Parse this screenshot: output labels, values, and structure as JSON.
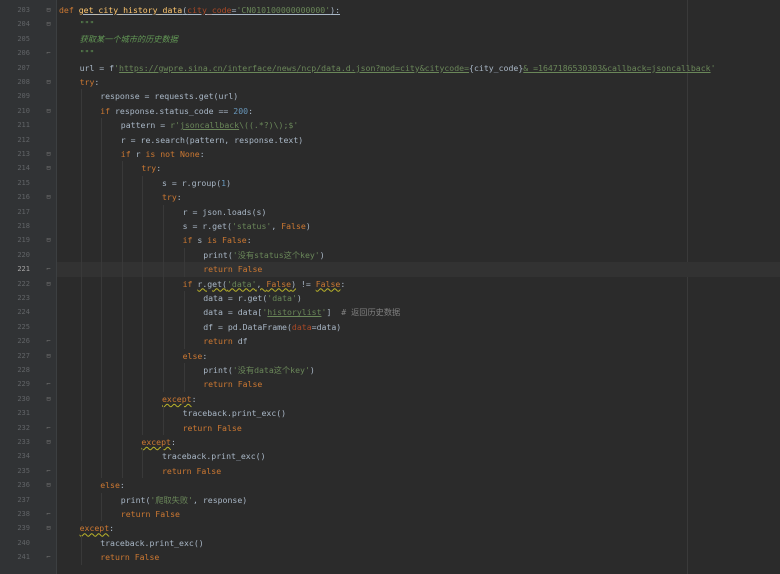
{
  "editor": {
    "current_line": 221,
    "lines": [
      {
        "n": "203",
        "indent": 0,
        "fold": "top",
        "tokens": [
          [
            "kw",
            "def "
          ],
          [
            "fn u2",
            "get_city_history_data"
          ],
          [
            "plain u2",
            "("
          ],
          [
            "param u2",
            "city_code"
          ],
          [
            "plain u2",
            "="
          ],
          [
            "str u2",
            "'CN010100000000000'"
          ],
          [
            "plain u2",
            "):"
          ]
        ]
      },
      {
        "n": "204",
        "indent": 1,
        "fold": "top",
        "tokens": [
          [
            "doc",
            "\"\"\""
          ]
        ]
      },
      {
        "n": "205",
        "indent": 1,
        "fold": "",
        "tokens": [
          [
            "doc",
            "获取某一个城市的历史数据"
          ]
        ]
      },
      {
        "n": "206",
        "indent": 1,
        "fold": "bot",
        "tokens": [
          [
            "doc",
            "\"\"\""
          ]
        ]
      },
      {
        "n": "207",
        "indent": 1,
        "fold": "",
        "tokens": [
          [
            "plain",
            "url = f"
          ],
          [
            "str",
            "'"
          ],
          [
            "str u",
            "https://gwpre.sina.cn/interface/news/ncp/data.d.json?mod=city&citycode="
          ],
          [
            "plain",
            "{city_code}"
          ],
          [
            "str u",
            "&_=1647186530303&callback=jsoncallback"
          ],
          [
            "str",
            "'"
          ]
        ]
      },
      {
        "n": "208",
        "indent": 1,
        "fold": "top",
        "tokens": [
          [
            "kw",
            "try"
          ],
          [
            "plain",
            ":"
          ]
        ]
      },
      {
        "n": "209",
        "indent": 2,
        "fold": "",
        "tokens": [
          [
            "plain",
            "response = requests.get(url)"
          ]
        ]
      },
      {
        "n": "210",
        "indent": 2,
        "fold": "top",
        "tokens": [
          [
            "kw",
            "if "
          ],
          [
            "plain",
            "response.status_code == "
          ],
          [
            "num",
            "200"
          ],
          [
            "plain",
            ":"
          ]
        ]
      },
      {
        "n": "211",
        "indent": 3,
        "fold": "",
        "tokens": [
          [
            "plain",
            "pattern = "
          ],
          [
            "str",
            "r'"
          ],
          [
            "str u",
            "jsoncallback"
          ],
          [
            "str",
            "\\((.*?)\\);$'"
          ]
        ]
      },
      {
        "n": "212",
        "indent": 3,
        "fold": "",
        "tokens": [
          [
            "plain",
            "r = re.search(pattern, response.text)"
          ]
        ]
      },
      {
        "n": "213",
        "indent": 3,
        "fold": "top",
        "tokens": [
          [
            "kw",
            "if "
          ],
          [
            "plain",
            "r "
          ],
          [
            "kw",
            "is not None"
          ],
          [
            "plain",
            ":"
          ]
        ]
      },
      {
        "n": "214",
        "indent": 4,
        "fold": "top",
        "tokens": [
          [
            "kw",
            "try"
          ],
          [
            "plain",
            ":"
          ]
        ]
      },
      {
        "n": "215",
        "indent": 5,
        "fold": "",
        "tokens": [
          [
            "plain",
            "s = r.group("
          ],
          [
            "num",
            "1"
          ],
          [
            "plain",
            ")"
          ]
        ]
      },
      {
        "n": "216",
        "indent": 5,
        "fold": "top",
        "tokens": [
          [
            "kw",
            "try"
          ],
          [
            "plain",
            ":"
          ]
        ]
      },
      {
        "n": "217",
        "indent": 6,
        "fold": "",
        "tokens": [
          [
            "plain",
            "r = json.loads(s)"
          ]
        ]
      },
      {
        "n": "218",
        "indent": 6,
        "fold": "",
        "tokens": [
          [
            "plain",
            "s = r.get("
          ],
          [
            "str",
            "'status'"
          ],
          [
            "plain",
            ", "
          ],
          [
            "kw",
            "False"
          ],
          [
            "plain",
            ")"
          ]
        ]
      },
      {
        "n": "219",
        "indent": 6,
        "fold": "top",
        "tokens": [
          [
            "kw",
            "if "
          ],
          [
            "plain",
            "s "
          ],
          [
            "kw",
            "is False"
          ],
          [
            "plain",
            ":"
          ]
        ]
      },
      {
        "n": "220",
        "indent": 7,
        "fold": "",
        "tokens": [
          [
            "plain",
            "print("
          ],
          [
            "str",
            "'没有status这个key'"
          ],
          [
            "plain",
            ")"
          ]
        ]
      },
      {
        "n": "221",
        "indent": 7,
        "fold": "bot",
        "tokens": [
          [
            "kw",
            "return False"
          ]
        ]
      },
      {
        "n": "222",
        "indent": 6,
        "fold": "top",
        "tokens": [
          [
            "kw",
            "if "
          ],
          [
            "plain uy",
            "r.get("
          ],
          [
            "str uy",
            "'data'"
          ],
          [
            "plain uy",
            ", "
          ],
          [
            "kw uy",
            "False"
          ],
          [
            "plain uy",
            ")"
          ],
          [
            "plain",
            " != "
          ],
          [
            "kw uy",
            "False"
          ],
          [
            "plain",
            ":"
          ]
        ]
      },
      {
        "n": "223",
        "indent": 7,
        "fold": "",
        "tokens": [
          [
            "plain",
            "data = r.get("
          ],
          [
            "str",
            "'data'"
          ],
          [
            "plain",
            ")"
          ]
        ]
      },
      {
        "n": "224",
        "indent": 7,
        "fold": "",
        "tokens": [
          [
            "plain",
            "data = data["
          ],
          [
            "str",
            "'"
          ],
          [
            "str u",
            "historylist"
          ],
          [
            "str",
            "'"
          ],
          [
            "plain",
            "]  "
          ],
          [
            "cm",
            "# 返回历史数据"
          ]
        ]
      },
      {
        "n": "225",
        "indent": 7,
        "fold": "",
        "tokens": [
          [
            "plain",
            "df = pd.DataFrame("
          ],
          [
            "param",
            "data"
          ],
          [
            "plain",
            "=data)"
          ]
        ]
      },
      {
        "n": "226",
        "indent": 7,
        "fold": "bot",
        "tokens": [
          [
            "kw",
            "return "
          ],
          [
            "plain",
            "df"
          ]
        ]
      },
      {
        "n": "227",
        "indent": 6,
        "fold": "top",
        "tokens": [
          [
            "kw",
            "else"
          ],
          [
            "plain",
            ":"
          ]
        ]
      },
      {
        "n": "228",
        "indent": 7,
        "fold": "",
        "tokens": [
          [
            "plain",
            "print("
          ],
          [
            "str",
            "'没有data这个key'"
          ],
          [
            "plain",
            ")"
          ]
        ]
      },
      {
        "n": "229",
        "indent": 7,
        "fold": "bot",
        "tokens": [
          [
            "kw",
            "return False"
          ]
        ]
      },
      {
        "n": "230",
        "indent": 5,
        "fold": "top",
        "tokens": [
          [
            "kw uy",
            "except"
          ],
          [
            "plain",
            ":"
          ]
        ]
      },
      {
        "n": "231",
        "indent": 6,
        "fold": "",
        "tokens": [
          [
            "plain",
            "traceback.print_exc()"
          ]
        ]
      },
      {
        "n": "232",
        "indent": 6,
        "fold": "bot",
        "tokens": [
          [
            "kw",
            "return False"
          ]
        ]
      },
      {
        "n": "233",
        "indent": 4,
        "fold": "top",
        "tokens": [
          [
            "kw uy",
            "except"
          ],
          [
            "plain",
            ":"
          ]
        ]
      },
      {
        "n": "234",
        "indent": 5,
        "fold": "",
        "tokens": [
          [
            "plain",
            "traceback.print_exc()"
          ]
        ]
      },
      {
        "n": "235",
        "indent": 5,
        "fold": "bot",
        "tokens": [
          [
            "kw",
            "return False"
          ]
        ]
      },
      {
        "n": "236",
        "indent": 2,
        "fold": "top",
        "tokens": [
          [
            "kw",
            "else"
          ],
          [
            "plain",
            ":"
          ]
        ]
      },
      {
        "n": "237",
        "indent": 3,
        "fold": "",
        "tokens": [
          [
            "plain",
            "print("
          ],
          [
            "str",
            "'爬取失败'"
          ],
          [
            "plain",
            ", response)"
          ]
        ]
      },
      {
        "n": "238",
        "indent": 3,
        "fold": "bot",
        "tokens": [
          [
            "kw",
            "return False"
          ]
        ]
      },
      {
        "n": "239",
        "indent": 1,
        "fold": "top",
        "tokens": [
          [
            "kw uy",
            "except"
          ],
          [
            "plain",
            ":"
          ]
        ]
      },
      {
        "n": "240",
        "indent": 2,
        "fold": "",
        "tokens": [
          [
            "plain",
            "traceback.print_exc()"
          ]
        ]
      },
      {
        "n": "241",
        "indent": 2,
        "fold": "bot",
        "tokens": [
          [
            "kw",
            "return False"
          ]
        ]
      }
    ]
  }
}
